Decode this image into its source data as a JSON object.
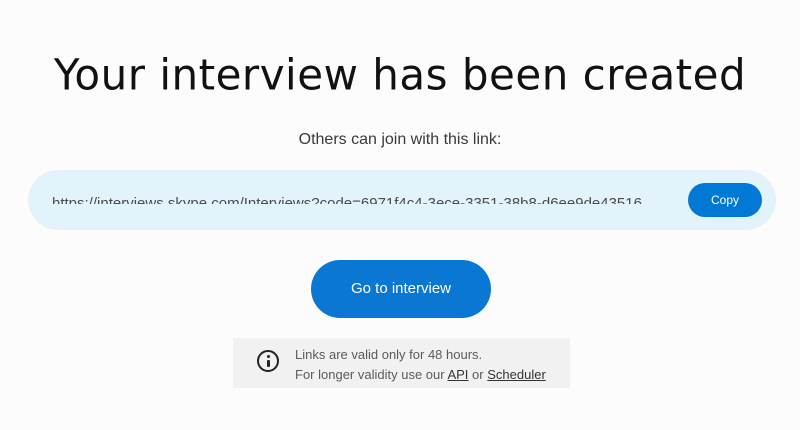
{
  "title": "Your interview has been created",
  "subtitle": "Others can join with this link:",
  "link": {
    "url": "https://interviews.skype.com/Interviews?code=6971f4c4-3ece-3351-38b8-d6ee9de43516",
    "copy_label": "Copy"
  },
  "go_button_label": "Go to interview",
  "info": {
    "icon": "info-icon",
    "line1": "Links are valid only for 48 hours.",
    "line2_prefix": "For longer validity use our ",
    "api_link": "API",
    "line2_middle": " or ",
    "scheduler_link": "Scheduler"
  },
  "colors": {
    "accent": "#0078d4",
    "link_box_bg": "#e3f3fb",
    "info_box_bg": "#f1f1f1"
  }
}
